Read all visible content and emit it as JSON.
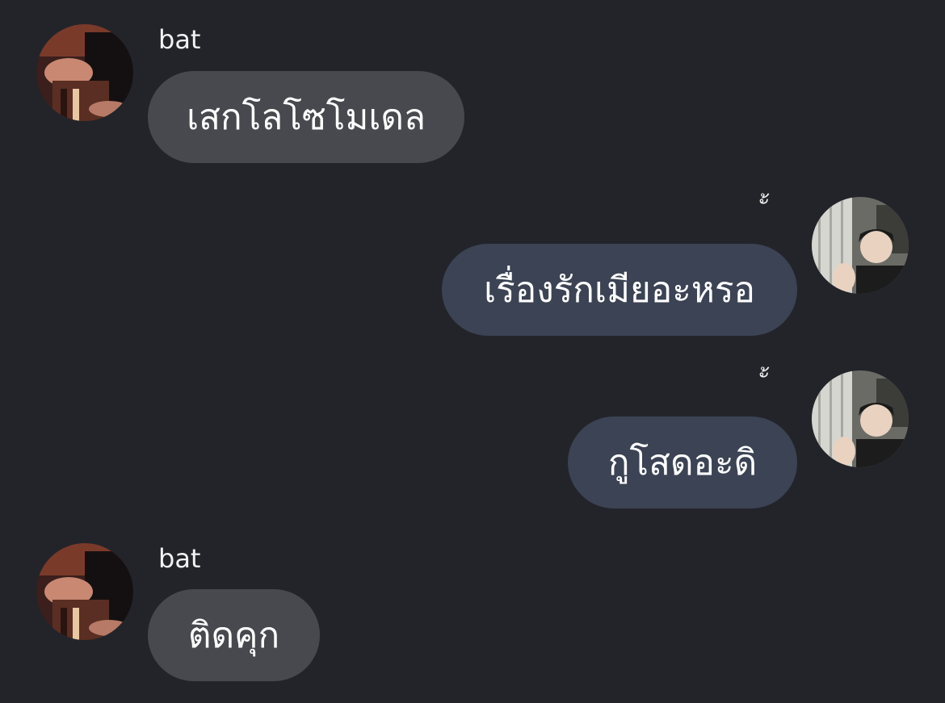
{
  "messages": [
    {
      "direction": "incoming",
      "sender": "bat",
      "text": "เสกโลโซโมเดล",
      "avatar_icon": "avatar-bat"
    },
    {
      "direction": "outgoing",
      "reaction": "ั้",
      "text": "เรื่องรักเมียอะหรอ",
      "avatar_icon": "avatar-self"
    },
    {
      "direction": "outgoing",
      "reaction": "ั้",
      "text": "กูโสดอะดิ",
      "avatar_icon": "avatar-self"
    },
    {
      "direction": "incoming",
      "sender": "bat",
      "text": "ติดคุก",
      "avatar_icon": "avatar-bat"
    }
  ],
  "colors": {
    "background": "#23242a",
    "incoming_bubble": "#48494f",
    "outgoing_bubble": "#3b4354",
    "text": "#ffffff"
  }
}
